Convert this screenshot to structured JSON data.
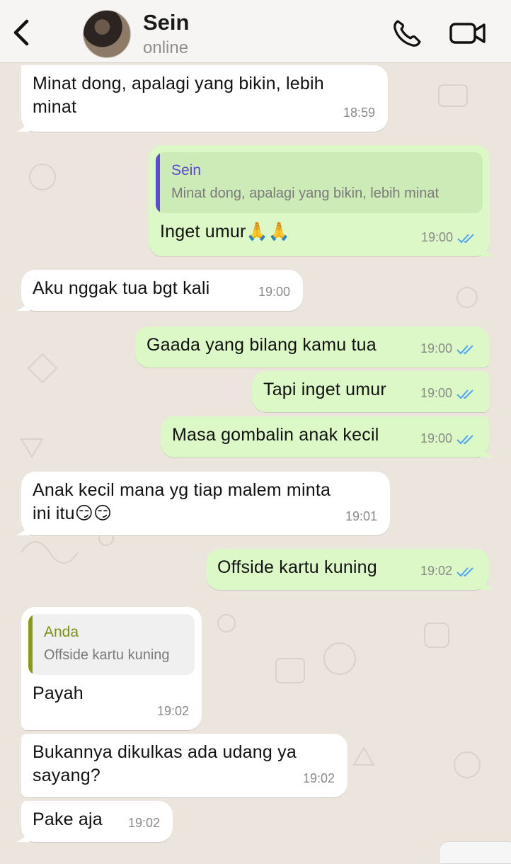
{
  "header": {
    "contact_name": "Sein",
    "status": "online",
    "icons": [
      "back-chevron-icon",
      "phone-icon",
      "video-camera-icon"
    ]
  },
  "messages": [
    {
      "dir": "in",
      "text": "Minat dong, apalagi yang bikin, lebih\nminat",
      "time": "18:59"
    },
    {
      "dir": "out",
      "quote_author": "Sein",
      "quote_text": "Minat dong, apalagi yang bikin, lebih minat",
      "text": "Inget umur🙏🙏",
      "time": "19:00"
    },
    {
      "dir": "in",
      "text": "Aku nggak tua bgt kali",
      "time": "19:00"
    },
    {
      "dir": "out",
      "text": "Gaada yang bilang kamu tua",
      "time": "19:00"
    },
    {
      "dir": "out",
      "text": "Tapi inget umur",
      "time": "19:00"
    },
    {
      "dir": "out",
      "text": "Masa gombalin anak kecil",
      "time": "19:00"
    },
    {
      "dir": "in",
      "text": "Anak kecil mana yg tiap malem minta\nini itu😏😏",
      "time": "19:01"
    },
    {
      "dir": "out",
      "text": "Offside kartu kuning",
      "time": "19:02"
    },
    {
      "dir": "in",
      "quote_author": "Anda",
      "quote_text": "Offside kartu kuning",
      "text": "Payah",
      "time": "19:02"
    },
    {
      "dir": "in",
      "text": "Bukannya dikulkas ada udang ya\nsayang?",
      "time": "19:02"
    },
    {
      "dir": "in",
      "text": "Pake aja",
      "time": "19:02"
    }
  ],
  "colors": {
    "incoming_bubble": "#ffffff",
    "outgoing_bubble": "#dcf8c6",
    "read_ticks": "#4fa3f7",
    "wallpaper": "#ece5dd"
  }
}
